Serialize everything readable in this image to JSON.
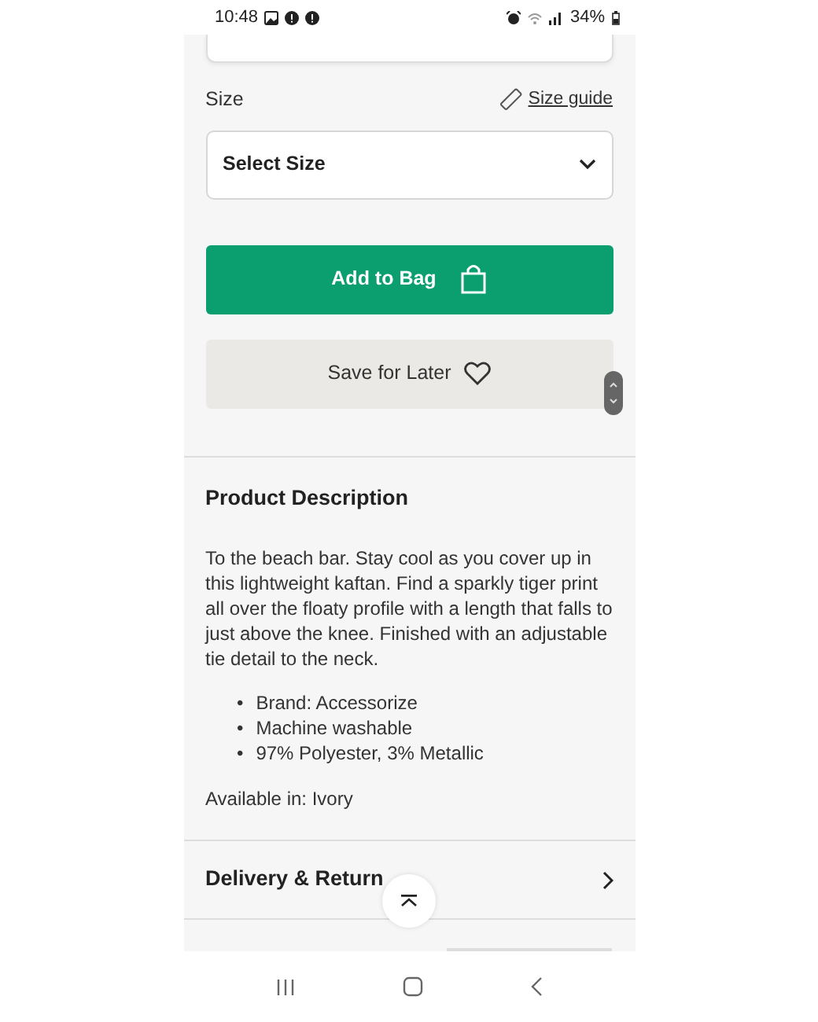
{
  "status_bar": {
    "time": "10:48",
    "battery": "34%"
  },
  "size": {
    "label": "Size",
    "guide_link": "Size guide",
    "select": {
      "value": "Select Size"
    }
  },
  "buttons": {
    "add_to_bag": "Add to Bag",
    "save_for_later": "Save for Later"
  },
  "product_description": {
    "title": "Product Description",
    "text": "To the beach bar. Stay cool as you cover up in this lightweight kaftan. Find a sparkly tiger print all over the floaty profile with a length that falls to just above the knee. Finished with an adjustable tie detail to the neck.",
    "bullets": [
      {
        "marker": "•",
        "text": "Brand: Accessorize"
      },
      {
        "marker": "•",
        "text": "Machine washable"
      },
      {
        "marker": "•",
        "text": "97% Polyester, 3% Metallic"
      }
    ],
    "availability": "Available in: Ivory"
  },
  "sections": [
    {
      "title": "Delivery & Return"
    }
  ]
}
